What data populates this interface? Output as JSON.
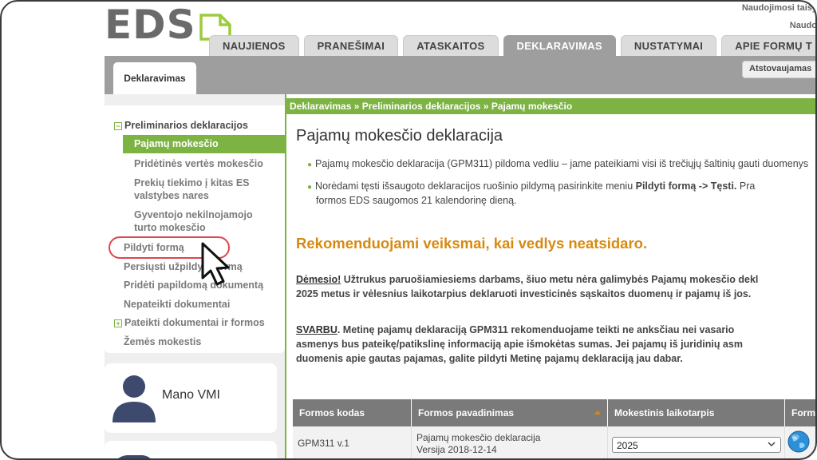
{
  "header": {
    "logo_text": "EDS",
    "top_link_1": "Naudojimosi taisy",
    "top_link_2": "Naudo"
  },
  "nav": {
    "tabs": [
      "NAUJIENOS",
      "PRANEŠIMAI",
      "ATASKAITOS",
      "DEKLARAVIMAS",
      "NUSTATYMAI",
      "APIE FORMŲ T"
    ],
    "active_index": 3
  },
  "subnav": {
    "active_tab": "Deklaravimas",
    "right_button": "Atstovaujamas"
  },
  "sidebar": {
    "section_preliminary": "Preliminarios deklaracijos",
    "items_preliminary": [
      "Pajamų mokesčio",
      "Pridėtinės vertės mokesčio",
      "Prekių tiekimo į kitas ES valstybes nares",
      "Gyventojo nekilnojamojo turto mokesčio"
    ],
    "items_main": [
      "Pildyti formą",
      "Persiųsti užpildytą formą",
      "Pridėti papildomą dokumentą",
      "Nepateikti dokumentai"
    ],
    "section_submit": "Pateikti dokumentai ir formos",
    "item_land": "Žemės mokestis"
  },
  "cards": {
    "mano_vmi": "Mano VMI"
  },
  "main": {
    "breadcrumb": "Deklaravimas »  Preliminarios deklaracijos  » Pajamų mokesčio",
    "title": "Pajamų mokesčio deklaracija",
    "bullet_1": "Pajamų mokesčio deklaracija (GPM311) pildoma vedliu – jame pateikiami visi iš trečiųjų šaltinių gauti duomenys",
    "bullet_2a": "Norėdami tęsti išsaugoto deklaracijos ruošinio pildymą pasirinkite meniu ",
    "bullet_2b": "Pildyti formą -> Tęsti.",
    "bullet_2c": " Pra",
    "bullet_2d": "formos EDS saugomos 21 kalendorinę dieną.",
    "recommend": "Rekomenduojami veiksmai, kai vedlys neatsidaro.",
    "attention_label": "Dėmesio!",
    "attention_text": " Užtrukus paruošiamiesiems darbams, šiuo metu nėra galimybės Pajamų mokesčio dekl",
    "attention_text_2": "2025 metus ir vėlesnius laikotarpius deklaruoti investicinės sąskaitos duomenų ir pajamų iš jos.",
    "important_label": "SVARBU",
    "important_text": ". Metinę pajamų deklaraciją GPM311 rekomenduojame teikti ne anksčiau nei vasario",
    "important_text_2": "asmenys bus pateikę/patikslinę informaciją apie išmokėtas sumas. Jei pajamų iš juridinių asm",
    "important_text_3": "duomenis apie gautas pajamas, galite pildyti Metinę pajamų deklaraciją jau dabar."
  },
  "table": {
    "headers": [
      "Formos kodas",
      "Formos pavadinimas",
      "Mokestinis laikotarpis",
      "Forma"
    ],
    "row": {
      "code": "GPM311 v.1",
      "name": "Pajamų mokesčio deklaracija",
      "version": "Versija 2018-12-14",
      "period": "2025"
    }
  },
  "colors": {
    "accent_green": "#7cb342",
    "header_gray": "#9e9e9e",
    "recommend_orange": "#d68a12",
    "highlight_red": "#e0454a"
  }
}
